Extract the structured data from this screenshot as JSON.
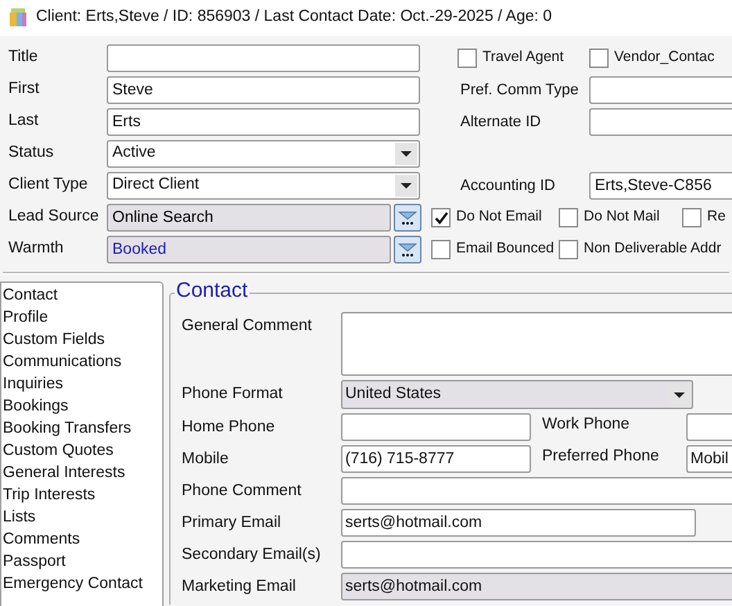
{
  "title_bar": {
    "text": "Client: Erts,Steve /  ID: 856903 / Last Contact Date: Oct.-29-2025 / Age: 0"
  },
  "top_form": [
    {
      "label": "Title",
      "control": {
        "kind": "text"
      },
      "right": [
        {
          "kind": "checkbox",
          "label": "Travel Agent",
          "checked": false
        },
        {
          "kind": "checkbox",
          "label": "Vendor_Contac",
          "checked": false
        }
      ]
    },
    {
      "label": "First",
      "control": {
        "kind": "text",
        "value": "Steve"
      },
      "right": [
        {
          "kind": "field",
          "label": "Pref. Comm Type"
        }
      ]
    },
    {
      "label": "Last",
      "control": {
        "kind": "text",
        "value": "Erts"
      },
      "right": [
        {
          "kind": "field",
          "label": "Alternate ID"
        }
      ]
    },
    {
      "label": "Status",
      "control": {
        "kind": "select",
        "value": "Active"
      }
    },
    {
      "label": "Client Type",
      "control": {
        "kind": "select",
        "value": "Direct Client"
      },
      "right": [
        {
          "kind": "field",
          "label": "Accounting ID",
          "value": "Erts,Steve-C856"
        }
      ]
    },
    {
      "label": "Lead Source",
      "control": {
        "kind": "lookup",
        "value": "Online Search",
        "color": "#000000"
      },
      "right": [
        {
          "kind": "checkbox",
          "label": "Do Not Email",
          "checked": true
        },
        {
          "kind": "checkbox",
          "label": "Do Not Mail",
          "checked": false
        },
        {
          "kind": "checkbox",
          "label": "Re",
          "checked": false
        }
      ]
    },
    {
      "label": "Warmth",
      "control": {
        "kind": "lookup",
        "value": "Booked",
        "color": "#1c1cb4"
      },
      "right": [
        {
          "kind": "checkbox",
          "label": "Email Bounced",
          "checked": false
        },
        {
          "kind": "checkbox",
          "label": "Non Deliverable Addr",
          "checked": false
        }
      ]
    }
  ],
  "nav": {
    "items": [
      "Contact",
      "Profile",
      "Custom Fields",
      "Communications",
      "Inquiries",
      "Bookings",
      "Booking Transfers",
      "Custom Quotes",
      "General Interests",
      "Trip Interests",
      "Lists",
      "Comments",
      "Passport",
      "Emergency Contact"
    ]
  },
  "contact": {
    "title": "Contact",
    "rows": [
      {
        "label": "General Comment",
        "fields": [
          {
            "kind": "memo"
          }
        ]
      },
      {
        "label": "Phone Format",
        "fields": [
          {
            "kind": "select",
            "value": "United States"
          }
        ]
      },
      {
        "label": "Home Phone",
        "fields": [
          {
            "kind": "short"
          },
          {
            "kind": "side_label",
            "value": "Work Phone"
          },
          {
            "kind": "tail"
          }
        ]
      },
      {
        "label": "Mobile",
        "fields": [
          {
            "kind": "short",
            "value": "(716) 715-8777"
          },
          {
            "kind": "side_label",
            "value": "Preferred Phone"
          },
          {
            "kind": "tail",
            "value": "Mobil"
          }
        ]
      },
      {
        "label": "Phone Comment",
        "fields": [
          {
            "kind": "long"
          }
        ]
      },
      {
        "label": "Primary Email",
        "fields": [
          {
            "kind": "medium",
            "value": "serts@hotmail.com"
          }
        ]
      },
      {
        "label": "Secondary Email(s)",
        "fields": [
          {
            "kind": "long"
          }
        ]
      },
      {
        "label": "Marketing Email",
        "fields": [
          {
            "kind": "readonly",
            "value": "serts@hotmail.com"
          }
        ]
      }
    ]
  }
}
